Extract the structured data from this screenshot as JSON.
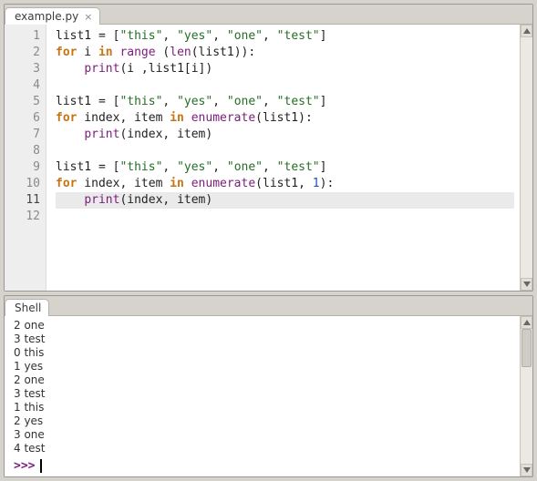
{
  "editor": {
    "tab_label": "example.py",
    "current_line": 11,
    "lines": [
      {
        "n": 1,
        "tokens": [
          [
            "",
            "list1 = ["
          ],
          [
            "str",
            "\"this\""
          ],
          [
            "",
            ", "
          ],
          [
            "str",
            "\"yes\""
          ],
          [
            "",
            ", "
          ],
          [
            "str",
            "\"one\""
          ],
          [
            "",
            ", "
          ],
          [
            "str",
            "\"test\""
          ],
          [
            "",
            "]"
          ]
        ]
      },
      {
        "n": 2,
        "tokens": [
          [
            "kw",
            "for"
          ],
          [
            "",
            " i "
          ],
          [
            "kw",
            "in"
          ],
          [
            "",
            " "
          ],
          [
            "builtin",
            "range"
          ],
          [
            "",
            " ("
          ],
          [
            "builtin",
            "len"
          ],
          [
            "",
            "(list1)):"
          ]
        ]
      },
      {
        "n": 3,
        "tokens": [
          [
            "",
            "    "
          ],
          [
            "builtin",
            "print"
          ],
          [
            "",
            "(i ,list1[i])"
          ]
        ]
      },
      {
        "n": 4,
        "tokens": []
      },
      {
        "n": 5,
        "tokens": [
          [
            "",
            "list1 = ["
          ],
          [
            "str",
            "\"this\""
          ],
          [
            "",
            ", "
          ],
          [
            "str",
            "\"yes\""
          ],
          [
            "",
            ", "
          ],
          [
            "str",
            "\"one\""
          ],
          [
            "",
            ", "
          ],
          [
            "str",
            "\"test\""
          ],
          [
            "",
            "]"
          ]
        ]
      },
      {
        "n": 6,
        "tokens": [
          [
            "kw",
            "for"
          ],
          [
            "",
            " index, item "
          ],
          [
            "kw",
            "in"
          ],
          [
            "",
            " "
          ],
          [
            "builtin",
            "enumerate"
          ],
          [
            "",
            "(list1):"
          ]
        ]
      },
      {
        "n": 7,
        "tokens": [
          [
            "",
            "    "
          ],
          [
            "builtin",
            "print"
          ],
          [
            "",
            "(index, item)"
          ]
        ]
      },
      {
        "n": 8,
        "tokens": []
      },
      {
        "n": 9,
        "tokens": [
          [
            "",
            "list1 = ["
          ],
          [
            "str",
            "\"this\""
          ],
          [
            "",
            ", "
          ],
          [
            "str",
            "\"yes\""
          ],
          [
            "",
            ", "
          ],
          [
            "str",
            "\"one\""
          ],
          [
            "",
            ", "
          ],
          [
            "str",
            "\"test\""
          ],
          [
            "",
            "]"
          ]
        ]
      },
      {
        "n": 10,
        "tokens": [
          [
            "kw",
            "for"
          ],
          [
            "",
            " index, item "
          ],
          [
            "kw",
            "in"
          ],
          [
            "",
            " "
          ],
          [
            "builtin",
            "enumerate"
          ],
          [
            "",
            "(list1, "
          ],
          [
            "num",
            "1"
          ],
          [
            "",
            "):"
          ]
        ]
      },
      {
        "n": 11,
        "tokens": [
          [
            "",
            "    "
          ],
          [
            "builtin",
            "print"
          ],
          [
            "",
            "(index, item)"
          ]
        ]
      },
      {
        "n": 12,
        "tokens": []
      }
    ]
  },
  "shell": {
    "tab_label": "Shell",
    "output": [
      "2 one",
      "3 test",
      "0 this",
      "1 yes",
      "2 one",
      "3 test",
      "1 this",
      "2 yes",
      "3 one",
      "4 test"
    ],
    "prompt": ">>>"
  }
}
